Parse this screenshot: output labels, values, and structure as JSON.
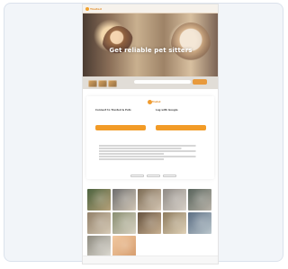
{
  "site": {
    "logo_text": "Trusted",
    "nav": [
      "",
      "",
      "",
      ""
    ],
    "hero": {
      "title": "Get reliable pet sitters",
      "subtitle": ""
    },
    "modal": {
      "left_title": "Connect to Trusted & Pets",
      "left_text": "",
      "left_button": "",
      "left_link": "",
      "right_title": "Log with Google",
      "right_text": "",
      "right_button": "",
      "right_link": "",
      "legal_text": [
        "",
        "",
        "",
        "",
        "",
        ""
      ],
      "action_1": "",
      "action_2": "",
      "action_3": ""
    },
    "footer": ""
  }
}
